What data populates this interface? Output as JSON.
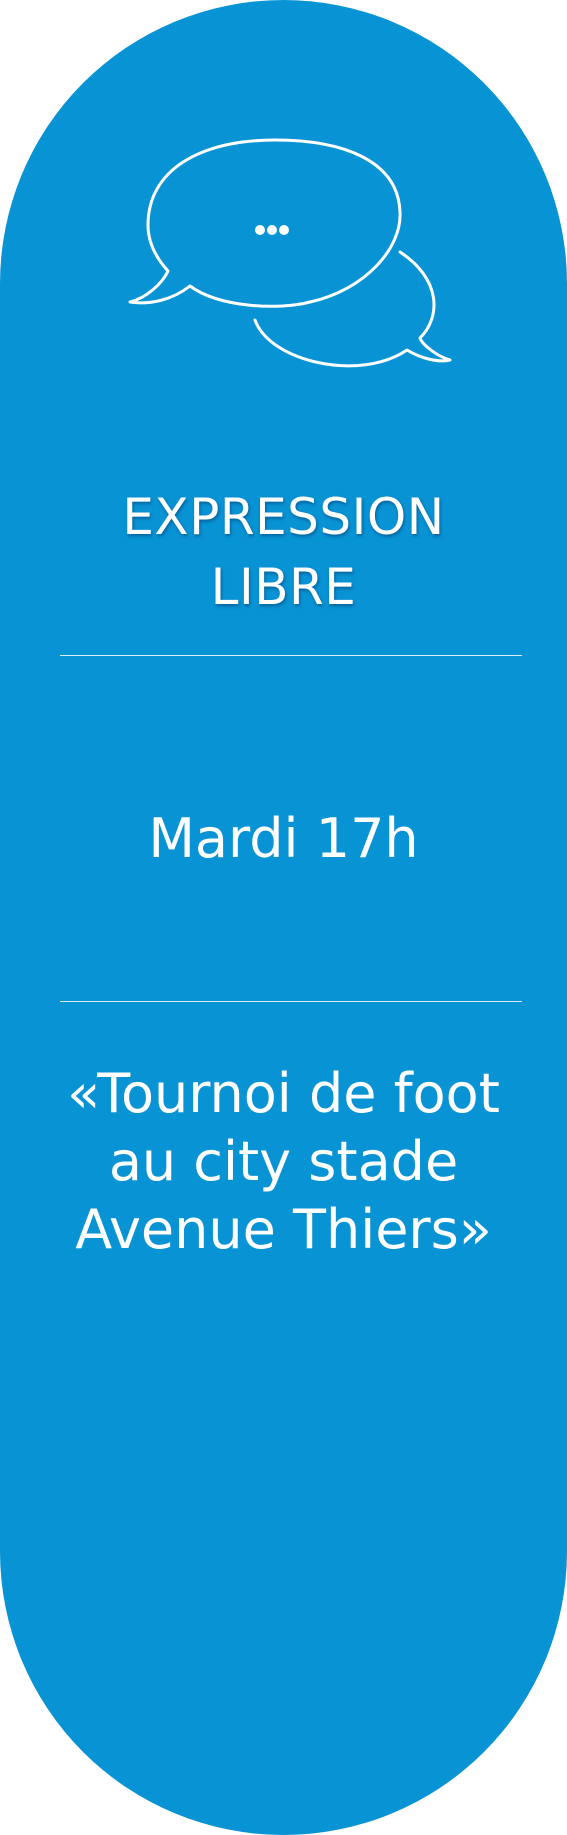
{
  "card": {
    "background_color": "#0893d5",
    "text_color": "#ffffff",
    "icon": "speech-bubbles-icon",
    "title_lines": [
      "EXPRESSION",
      "LIBRE"
    ],
    "time": "Mardi 17h",
    "event_lines": [
      "«Tournoi de foot",
      "au city stade",
      "Avenue Thiers»"
    ]
  }
}
